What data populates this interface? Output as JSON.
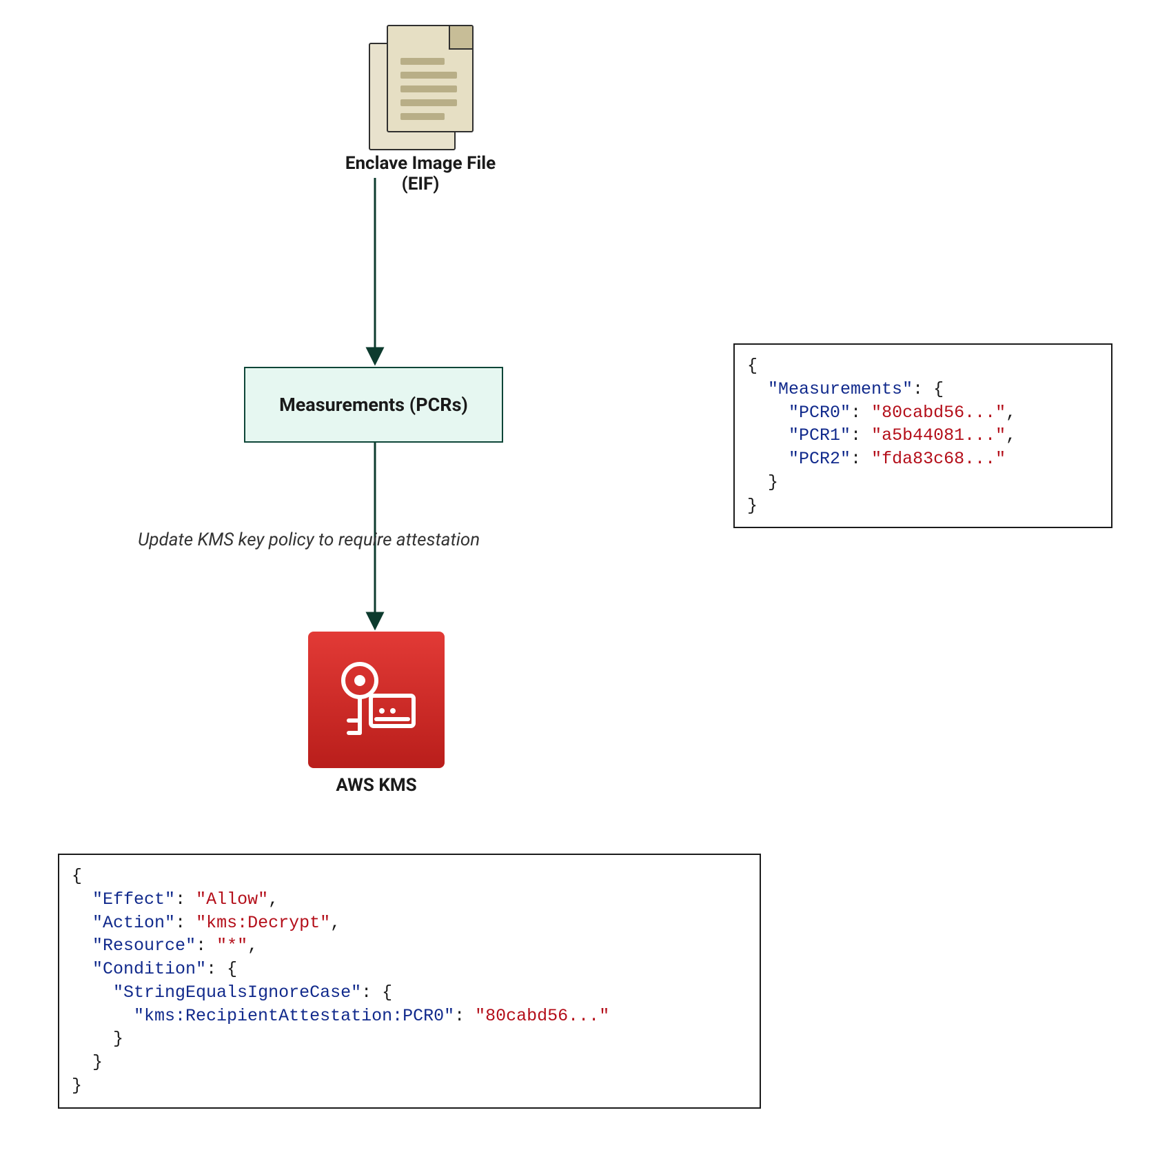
{
  "eif": {
    "label": "Enclave Image File (EIF)"
  },
  "measurements_box": {
    "label": "Measurements (PCRs)"
  },
  "edge": {
    "label": "Update KMS key policy to require attestation"
  },
  "kms": {
    "label": "AWS KMS"
  },
  "measurements_json": {
    "root_key": "Measurements",
    "pcr0_key": "PCR0",
    "pcr0_val": "80cabd56...",
    "pcr1_key": "PCR1",
    "pcr1_val": "a5b44081...",
    "pcr2_key": "PCR2",
    "pcr2_val": "fda83c68..."
  },
  "policy_json": {
    "effect_key": "Effect",
    "effect_val": "Allow",
    "action_key": "Action",
    "action_val": "kms:Decrypt",
    "resource_key": "Resource",
    "resource_val": "*",
    "condition_key": "Condition",
    "cond_op_key": "StringEqualsIgnoreCase",
    "cond_attr_key": "kms:RecipientAttestation:PCR0",
    "cond_attr_val": "80cabd56..."
  },
  "colors": {
    "box_bg": "#e6f7f1",
    "box_border": "#0d4537",
    "kms_top": "#e23a36",
    "kms_bot": "#b91e1b",
    "json_key": "#112a8c",
    "json_str": "#b40f1a"
  }
}
